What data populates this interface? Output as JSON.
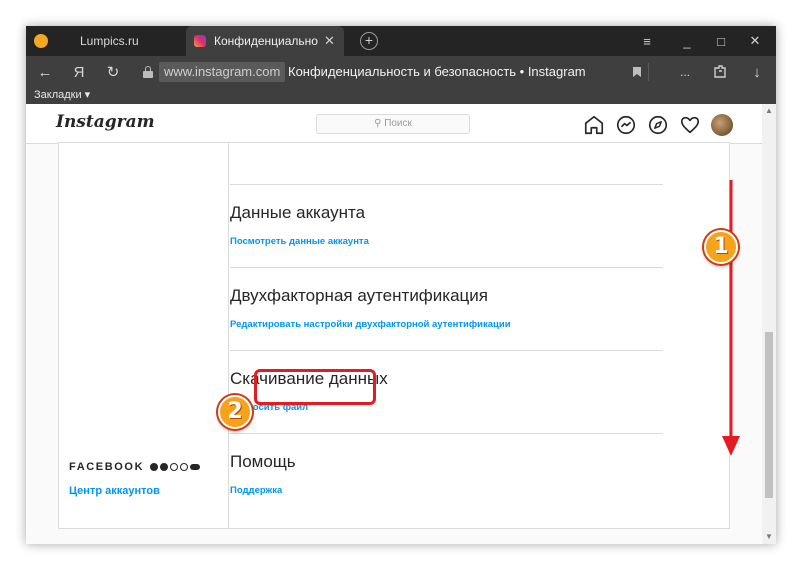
{
  "browser": {
    "tabs": [
      {
        "label": "Lumpics.ru",
        "active": false
      },
      {
        "label": "Конфиденциальность и",
        "active": true
      }
    ],
    "new_tab_icon": "+",
    "menu_icon": "≡",
    "minimize_icon": "_",
    "maximize_icon": "□",
    "close_icon": "✕",
    "tab_close_icon": "✕",
    "address": {
      "domain": "www.instagram.com",
      "page_title": "Конфиденциальность и безопасность • Instagram",
      "back_icon": "←",
      "yandex_icon": "Я",
      "reload_icon": "↻",
      "more_icon": "...",
      "download_icon": "↓"
    },
    "bookmarks_label": "Закладки ▾"
  },
  "instagram": {
    "logo": "Instagram",
    "search_placeholder": "Поиск",
    "search_icon": "⚲"
  },
  "sidebar": {
    "facebook_title": "FACEBOOK",
    "accounts_center_link": "Центр аккаунтов"
  },
  "sections": [
    {
      "heading": "Данные аккаунта",
      "link": "Посмотреть данные аккаунта"
    },
    {
      "heading": "Двухфакторная аутентификация",
      "link": "Редактировать настройки двухфакторной аутентификации"
    },
    {
      "heading": "Скачивание данных",
      "link": "Запросить файл"
    },
    {
      "heading": "Помощь",
      "link": "Поддержка"
    }
  ],
  "annotations": {
    "step1": "1",
    "step2": "2",
    "accent_color": "#e31b23",
    "badge_color": "#f6a21b"
  },
  "colors": {
    "link": "#0095f6",
    "tabbar": "#242424",
    "addressbar": "#3f3f3f"
  }
}
